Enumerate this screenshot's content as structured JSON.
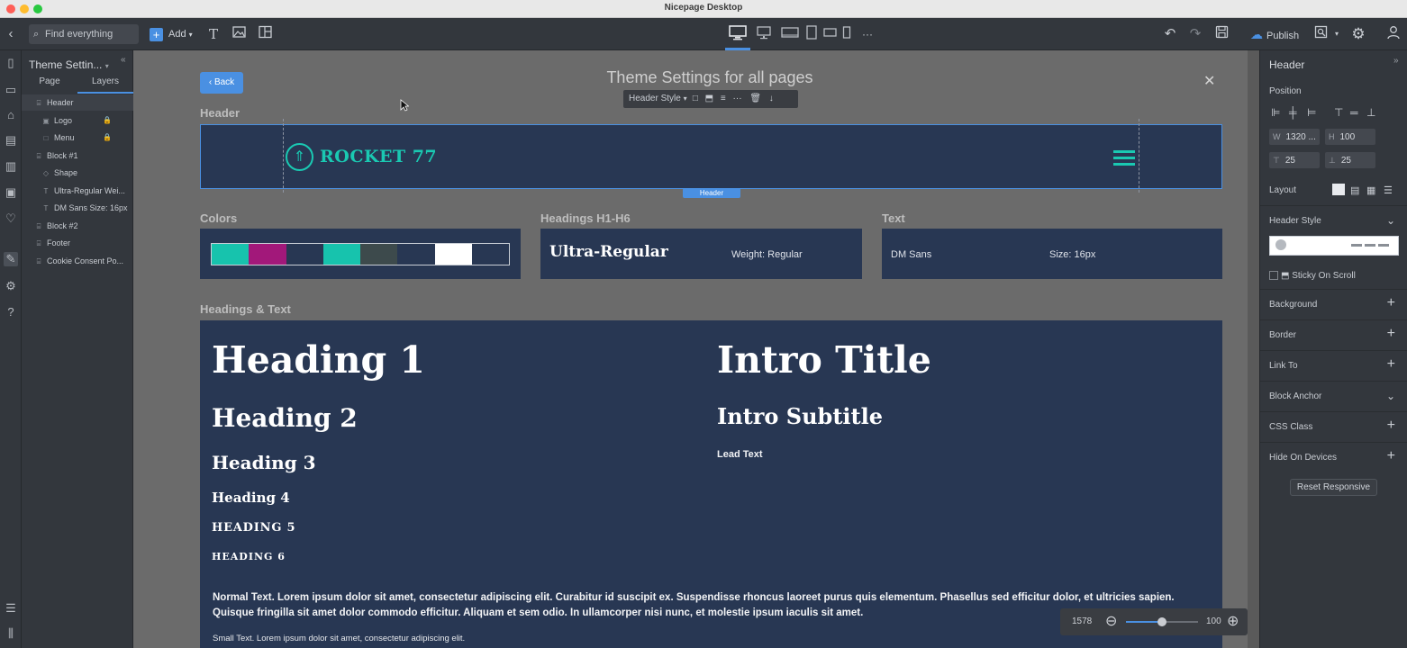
{
  "app": {
    "window_title": "Nicepage Desktop"
  },
  "toolbar": {
    "search_placeholder": "Find everything",
    "add_label": "Add",
    "publish_label": "Publish",
    "more_label": "···"
  },
  "layers_panel": {
    "title": "Theme Settin...",
    "tabs": [
      "Page",
      "Layers"
    ],
    "items": [
      {
        "label": "Header",
        "icon": "section-icon",
        "indent": 1
      },
      {
        "label": "Logo",
        "icon": "image-icon",
        "indent": 2,
        "locked": true
      },
      {
        "label": "Menu",
        "icon": "menu-box-icon",
        "indent": 2,
        "locked": true
      },
      {
        "label": "Block #1",
        "icon": "section-icon",
        "indent": 1
      },
      {
        "label": "Shape",
        "icon": "shape-icon",
        "indent": 2
      },
      {
        "label": "Ultra-Regular Wei...",
        "icon": "text-icon",
        "indent": 2
      },
      {
        "label": "DM Sans Size: 16px",
        "icon": "text-icon",
        "indent": 2
      },
      {
        "label": "Block #2",
        "icon": "section-icon",
        "indent": 1
      },
      {
        "label": "Footer",
        "icon": "section-icon",
        "indent": 1
      },
      {
        "label": "Cookie Consent Po...",
        "icon": "section-icon",
        "indent": 1
      }
    ]
  },
  "canvas": {
    "back_label": "Back",
    "page_title": "Theme Settings for all pages",
    "header_style_label": "Header Style",
    "sections": {
      "header": "Header",
      "colors": "Colors",
      "headings": "Headings H1-H6",
      "text": "Text",
      "headings_text": "Headings & Text"
    },
    "header_block": {
      "logo_text": "ROCKET 77",
      "badge": "Header"
    },
    "colors": [
      "#17c3ad",
      "#a2187a",
      "#283753",
      "#17c3ad",
      "#3d4a4c",
      "#283753",
      "#ffffff",
      "#283753"
    ],
    "headings_card": {
      "font": "Ultra-Regular",
      "weight": "Weight: Regular"
    },
    "text_card": {
      "font": "DM Sans",
      "size": "Size: 16px"
    },
    "headings": {
      "h1": "Heading 1",
      "h2": "Heading 2",
      "h3": "Heading 3",
      "h4": "Heading 4",
      "h5": "HEADING 5",
      "h6": "HEADING 6",
      "intro_title": "Intro Title",
      "intro_subtitle": "Intro Subtitle",
      "lead_text": "Lead Text"
    },
    "normal_text": "Normal Text. Lorem ipsum dolor sit amet, consectetur adipiscing elit. Curabitur id suscipit ex. Suspendisse rhoncus laoreet purus quis elementum. Phasellus sed efficitur dolor, et ultricies sapien. Quisque fringilla sit amet dolor commodo efficitur. Aliquam et sem odio. In ullamcorper nisi nunc, et molestie ipsum iaculis sit amet.",
    "small_text": "Small Text. Lorem ipsum dolor sit amet, consectetur adipiscing elit.",
    "zoom": {
      "width_value": "1578",
      "zoom_value": "100",
      "zoom_level": 0.5
    }
  },
  "right_panel": {
    "title": "Header",
    "position_label": "Position",
    "w_key": "W",
    "w_value": "1320 ...",
    "h_key": "H",
    "h_value": "100",
    "pad_top": "25",
    "pad_bottom": "25",
    "layout_label": "Layout",
    "header_style_label": "Header Style",
    "sticky_label": "Sticky On Scroll",
    "rows": [
      {
        "label": "Background",
        "action": "+"
      },
      {
        "label": "Border",
        "action": "+"
      },
      {
        "label": "Link To",
        "action": "+"
      },
      {
        "label": "Block Anchor",
        "action": "⌄"
      },
      {
        "label": "CSS Class",
        "action": "+"
      },
      {
        "label": "Hide On Devices",
        "action": "+"
      }
    ],
    "reset_label": "Reset Responsive"
  },
  "colors": {
    "accent": "#4a90e2",
    "brand_teal": "#1ac9b2",
    "navy": "#283753"
  }
}
